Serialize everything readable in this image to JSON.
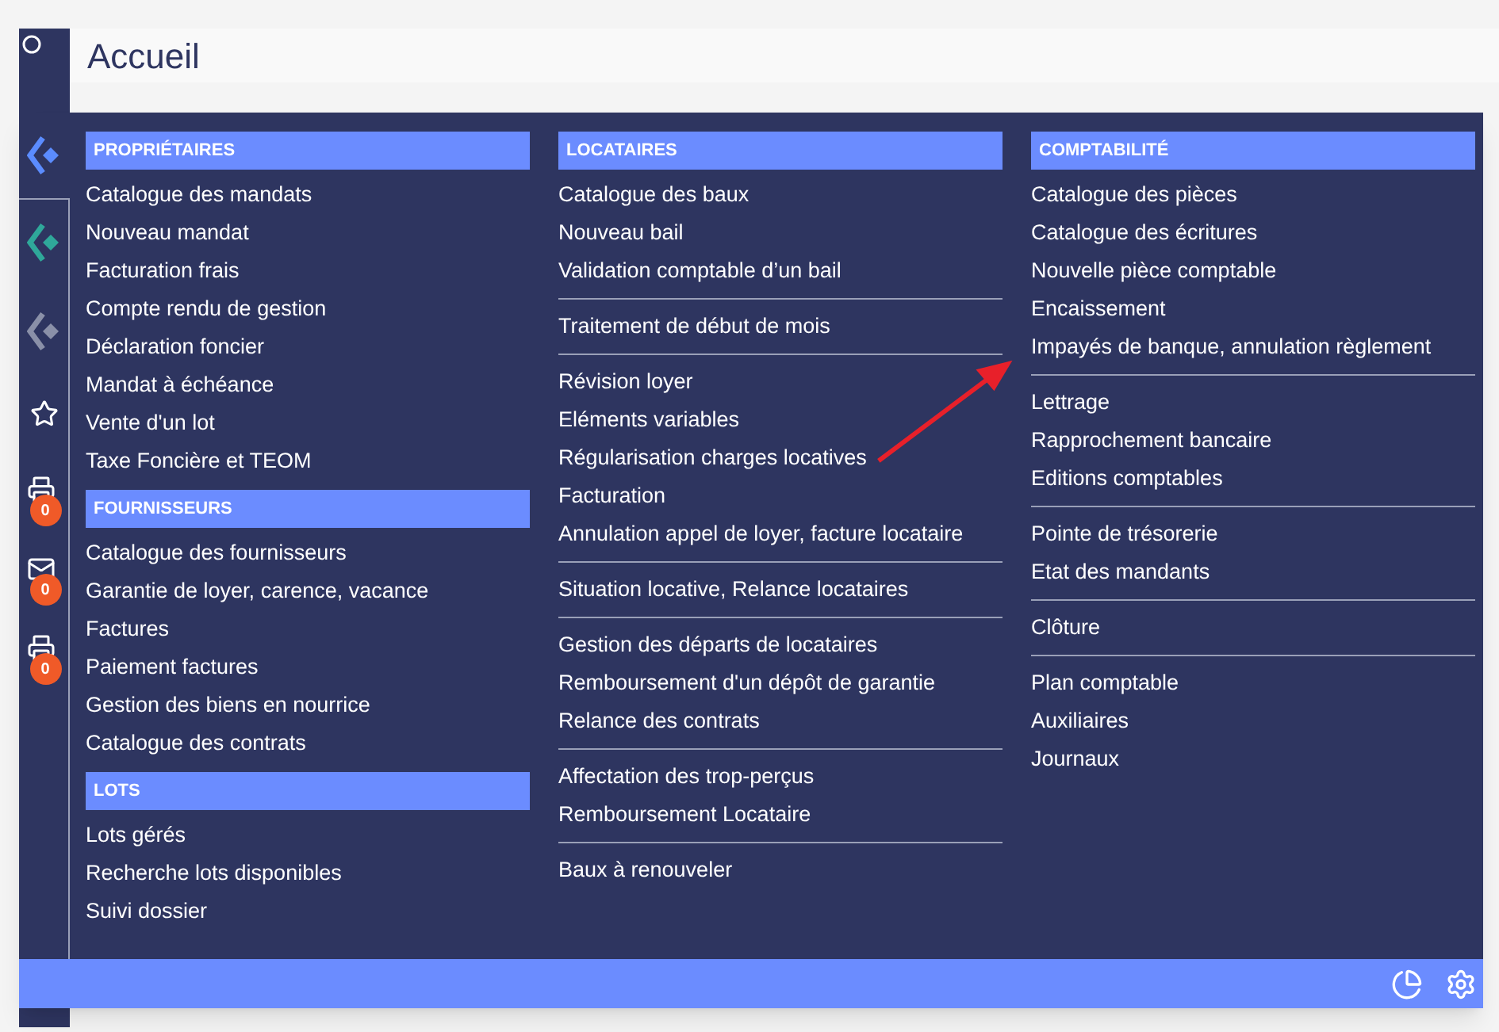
{
  "page": {
    "title": "Accueil"
  },
  "sidebar": {
    "badges": [
      "0",
      "0",
      "0"
    ]
  },
  "menu": {
    "columns": [
      {
        "sections": [
          {
            "title": "PROPRIÉTAIRES",
            "groups": [
              [
                "Catalogue des mandats",
                "Nouveau mandat",
                "Facturation frais",
                "Compte rendu de gestion",
                "Déclaration foncier",
                "Mandat à échéance",
                "Vente d'un lot",
                "Taxe Foncière et TEOM"
              ]
            ]
          },
          {
            "title": "FOURNISSEURS",
            "groups": [
              [
                "Catalogue des fournisseurs",
                "Garantie de loyer, carence, vacance",
                "Factures",
                "Paiement factures",
                "Gestion des biens en nourrice",
                "Catalogue des contrats"
              ]
            ]
          },
          {
            "title": "LOTS",
            "groups": [
              [
                "Lots gérés",
                "Recherche lots disponibles",
                "Suivi dossier"
              ]
            ]
          }
        ]
      },
      {
        "sections": [
          {
            "title": "LOCATAIRES",
            "groups": [
              [
                "Catalogue des baux",
                "Nouveau bail",
                "Validation comptable d’un bail"
              ],
              [
                "Traitement de début de mois"
              ],
              [
                "Révision loyer",
                "Eléments variables",
                "Régularisation charges locatives",
                "Facturation",
                "Annulation appel de loyer, facture locataire"
              ],
              [
                "Situation locative, Relance locataires"
              ],
              [
                "Gestion des départs de locataires",
                "Remboursement d'un dépôt de garantie",
                "Relance des contrats"
              ],
              [
                "Affectation des trop-perçus",
                "Remboursement Locataire"
              ],
              [
                "Baux à renouveler"
              ]
            ]
          }
        ]
      },
      {
        "sections": [
          {
            "title": "COMPTABILITÉ",
            "groups": [
              [
                "Catalogue des pièces",
                "Catalogue des écritures",
                "Nouvelle pièce comptable",
                "Encaissement",
                "Impayés de banque, annulation règlement"
              ],
              [
                "Lettrage",
                "Rapprochement bancaire",
                "Editions comptables"
              ],
              [
                "Pointe de trésorerie",
                "Etat des mandants"
              ],
              [
                "Clôture"
              ],
              [
                "Plan comptable",
                "Auxiliaires",
                "Journaux"
              ]
            ]
          }
        ]
      }
    ]
  }
}
